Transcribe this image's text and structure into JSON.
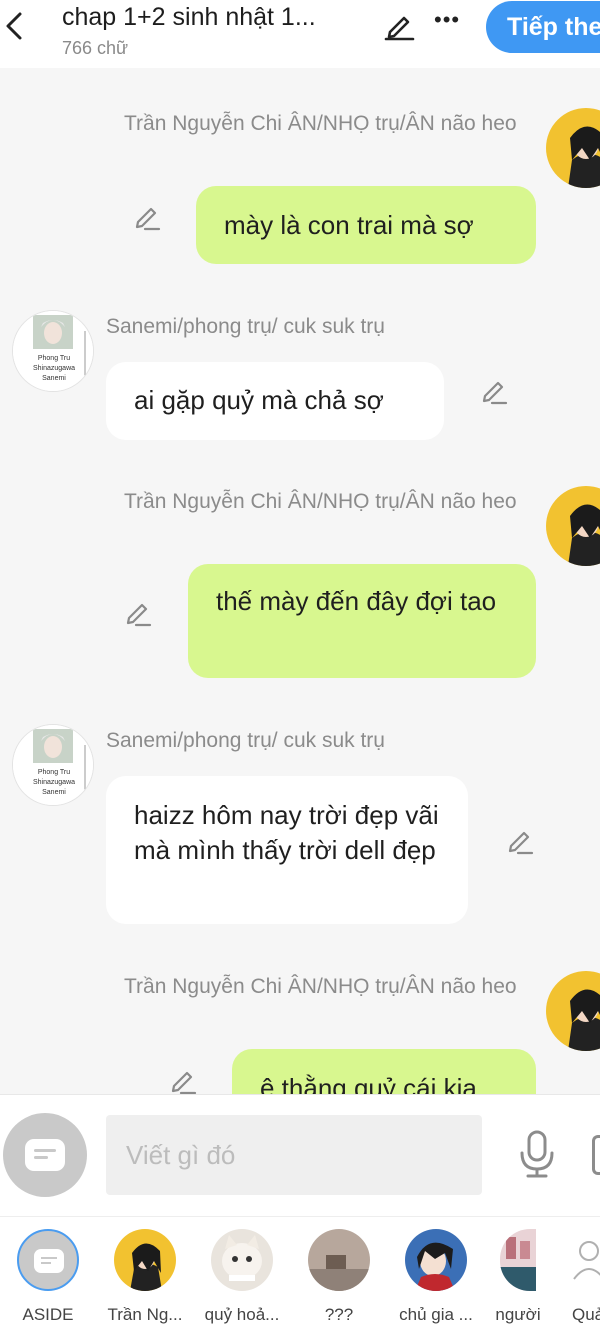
{
  "header": {
    "title": "chap 1+2 sinh nhật 1...",
    "word_count": "766 chữ",
    "next_button": "Tiếp the"
  },
  "messages": [
    {
      "side": "right",
      "name": "Trần Nguyễn Chi ÂN/NHỌ trụ/ÂN não heo",
      "text": "mày là con trai mà sợ"
    },
    {
      "side": "left",
      "name": "Sanemi/phong trụ/ cuk suk trụ",
      "text": "ai gặp quỷ mà chả sợ",
      "avatar_caption": [
        "Phong Tru",
        "Shinazugawa",
        "Sanemi"
      ]
    },
    {
      "side": "right",
      "name": "Trần Nguyễn Chi ÂN/NHỌ trụ/ÂN não heo",
      "text": "thế mày đến đây đợi tao"
    },
    {
      "side": "left",
      "name": "Sanemi/phong trụ/ cuk suk trụ",
      "text": "haizz hôm nay trời đẹp vãi mà mình thấy trời dell đẹp",
      "avatar_caption": [
        "Phong Tru",
        "Shinazugawa",
        "Sanemi"
      ]
    },
    {
      "side": "right",
      "name": "Trần Nguyễn Chi ÂN/NHỌ trụ/ÂN não heo",
      "text": "ê thằng quỷ cái kia"
    }
  ],
  "input": {
    "placeholder": "Viết gì đó"
  },
  "characters": [
    {
      "label": "ASIDE",
      "icon": "aside-icon"
    },
    {
      "label": "Trần Ng...",
      "icon": "character-avatar"
    },
    {
      "label": "quỷ hoả...",
      "icon": "cat-avatar"
    },
    {
      "label": "???",
      "icon": "unknown-avatar"
    },
    {
      "label": "chủ gia ...",
      "icon": "character-avatar"
    },
    {
      "label": "người",
      "icon": "character-avatar"
    },
    {
      "label": "Quả",
      "icon": "user-outline-icon"
    }
  ],
  "colors": {
    "accent": "#3f98f3",
    "bubble_right": "#d8f78f",
    "bubble_left": "#ffffff",
    "background": "#f6f6f6"
  }
}
